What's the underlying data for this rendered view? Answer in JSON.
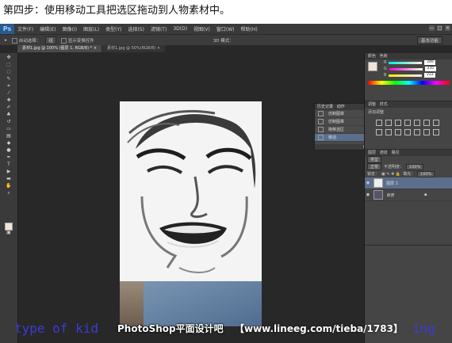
{
  "caption": "第四步：使用移动工具把选区拖动到人物素材中。",
  "app": {
    "logo": "Ps",
    "menus": [
      "文件(F)",
      "编辑(E)",
      "图像(I)",
      "图层(L)",
      "类型(Y)",
      "选择(S)",
      "滤镜(T)",
      "3D(D)",
      "视图(V)",
      "窗口(W)",
      "帮助(H)"
    ],
    "window_buttons": [
      "—",
      "□",
      "✕"
    ]
  },
  "options": {
    "tool": "▸",
    "auto_select_label": "自动选择：",
    "auto_select_value": "组",
    "transform_label": "显示变换控件",
    "mode_3d": "3D 模式：",
    "workspace": "基本功能"
  },
  "tabs": [
    {
      "label": "素材1.jpg @ 100% (图层 1, RGB/8) * ×",
      "active": true
    },
    {
      "label": "素材1.jpg @ 50%(RGB/8) ×",
      "active": false
    }
  ],
  "history_panel": {
    "tabs": [
      "历史记录",
      "动作"
    ],
    "items": [
      {
        "label": "仿制图章",
        "selected": false
      },
      {
        "label": "仿制图章",
        "selected": false
      },
      {
        "label": "拖移选区",
        "selected": false
      },
      {
        "label": "移动",
        "selected": true
      }
    ]
  },
  "color_panel": {
    "tabs": [
      "颜色",
      "色板"
    ],
    "rows": [
      {
        "channel": "R",
        "value": "246"
      },
      {
        "channel": "G",
        "value": "235"
      },
      {
        "channel": "B",
        "value": "222"
      }
    ],
    "accent_fg": "#f2e3d6"
  },
  "adjust_panel": {
    "tabs": [
      "调整",
      "样式"
    ],
    "heading": "添加调整"
  },
  "layers_panel": {
    "tabs": [
      "图层",
      "通道",
      "路径"
    ],
    "kind_label": "类型",
    "blend": "正常",
    "opacity_label": "不透明度：",
    "opacity": "100%",
    "lock_label": "锁定：",
    "fill_label": "填充：",
    "fill": "100%",
    "layers": [
      {
        "name": "图层 1",
        "selected": true
      },
      {
        "name": "背景",
        "selected": false
      }
    ]
  },
  "watermark": {
    "left_text": "type of kid",
    "brand": "PhotoShop平面设计吧",
    "url": "【www.lineeg.com/tieba/1783】",
    "right_text": "ing"
  }
}
